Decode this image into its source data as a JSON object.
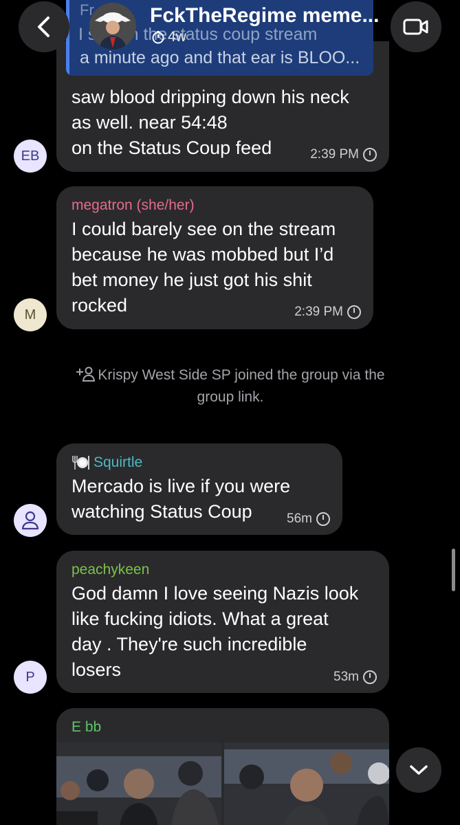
{
  "header": {
    "group_name": "FckTheRegime meme...",
    "subtitle": "4w",
    "quoted_from": "Fr",
    "quoted_line1": "I s  imon the status coup stream",
    "quoted_line2": "a minute ago and that ear is BLOO..."
  },
  "messages": [
    {
      "avatar": "EB",
      "text": "saw blood dripping down his neck\nas well. near 54:48\non the Status Coup feed",
      "time": "2:39 PM"
    },
    {
      "avatar": "M",
      "sender": "megatron (she/her)",
      "text": "I could barely see on the stream\nbecause he was mobbed but I’d\nbet money he just got his shit\nrocked",
      "time": "2:39 PM"
    },
    {
      "sender": "Squirtle",
      "text": "Mercado is live if you were\nwatching Status Coup",
      "time": "56m"
    },
    {
      "avatar": "P",
      "sender": "peachykeen",
      "text": "God damn I love seeing Nazis look\nlike fucking idiots. What a great\nday . They're such incredible\nlosers",
      "time": "53m"
    },
    {
      "sender": "E bb"
    }
  ],
  "system_message": "Krispy West Side SP joined the group via the\ngroup link.",
  "colors": {
    "megatron": "#e66b8a",
    "squirtle": "#4fb8c4",
    "peachykeen": "#7cc24a",
    "ebb": "#5fc46b",
    "bubble": "#2a2a2c",
    "avatar_bg": "#e9e4ff"
  },
  "icons": [
    "back-chevron-icon",
    "video-call-icon",
    "timer-icon",
    "add-person-icon",
    "person-icon",
    "plate-icon",
    "scroll-down-chevron-icon"
  ]
}
